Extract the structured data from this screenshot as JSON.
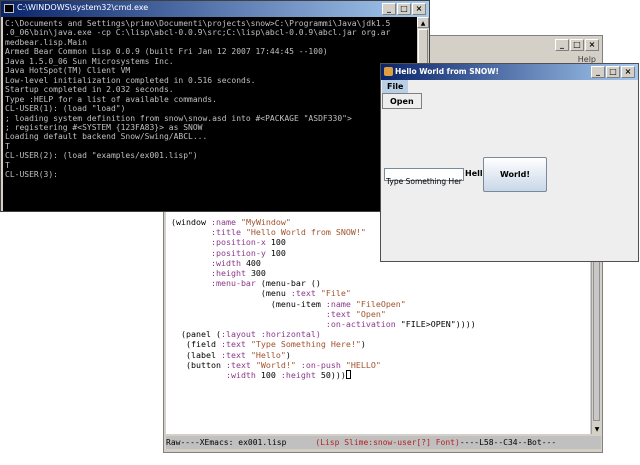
{
  "xemacs": {
    "help_label": "Help",
    "code_lines": [
      [
        {
          "t": "(window ",
          "c": ""
        },
        {
          "t": ":name ",
          "c": "kw"
        },
        {
          "t": "\"MyWindow\"",
          "c": "str"
        }
      ],
      [
        {
          "t": "        ",
          "c": ""
        },
        {
          "t": ":title ",
          "c": "kw"
        },
        {
          "t": "\"Hello World from SNOW!\"",
          "c": "str"
        }
      ],
      [
        {
          "t": "        ",
          "c": ""
        },
        {
          "t": ":position-x ",
          "c": "kw"
        },
        {
          "t": "100",
          "c": ""
        }
      ],
      [
        {
          "t": "        ",
          "c": ""
        },
        {
          "t": ":position-y ",
          "c": "kw"
        },
        {
          "t": "100",
          "c": ""
        }
      ],
      [
        {
          "t": "        ",
          "c": ""
        },
        {
          "t": ":width ",
          "c": "kw"
        },
        {
          "t": "400",
          "c": ""
        }
      ],
      [
        {
          "t": "        ",
          "c": ""
        },
        {
          "t": ":height ",
          "c": "kw"
        },
        {
          "t": "300",
          "c": ""
        }
      ],
      [
        {
          "t": "        ",
          "c": ""
        },
        {
          "t": ":menu-bar ",
          "c": "kw"
        },
        {
          "t": "(menu-bar ()",
          "c": ""
        }
      ],
      [
        {
          "t": "                  (menu ",
          "c": ""
        },
        {
          "t": ":text ",
          "c": "kw"
        },
        {
          "t": "\"File\"",
          "c": "str"
        }
      ],
      [
        {
          "t": "                    (menu-item ",
          "c": ""
        },
        {
          "t": ":name ",
          "c": "kw"
        },
        {
          "t": "\"FileOpen\"",
          "c": "str"
        }
      ],
      [
        {
          "t": "                               ",
          "c": ""
        },
        {
          "t": ":text ",
          "c": "kw"
        },
        {
          "t": "\"Open\"",
          "c": "str"
        }
      ],
      [
        {
          "t": "                               ",
          "c": ""
        },
        {
          "t": ":on-activation ",
          "c": "kw"
        },
        {
          "t": "\"FILE>OPEN\"))))",
          "c": ""
        }
      ],
      [
        {
          "t": "  (panel (",
          "c": ""
        },
        {
          "t": ":layout ",
          "c": "kw"
        },
        {
          "t": ":horizontal)",
          "c": "kw"
        }
      ],
      [
        {
          "t": "   (field ",
          "c": ""
        },
        {
          "t": ":text ",
          "c": "kw"
        },
        {
          "t": "\"Type Something Here!\"",
          "c": "str"
        },
        {
          "t": ")",
          "c": ""
        }
      ],
      [
        {
          "t": "   (label ",
          "c": ""
        },
        {
          "t": ":text ",
          "c": "kw"
        },
        {
          "t": "\"Hello\"",
          "c": "str"
        },
        {
          "t": ")",
          "c": ""
        }
      ],
      [
        {
          "t": "   (button ",
          "c": ""
        },
        {
          "t": ":text ",
          "c": "kw"
        },
        {
          "t": "\"World!\" ",
          "c": "str"
        },
        {
          "t": ":on-push ",
          "c": "kw"
        },
        {
          "t": "\"HELLO\"",
          "c": "str"
        }
      ],
      [
        {
          "t": "           ",
          "c": ""
        },
        {
          "t": ":width ",
          "c": "kw"
        },
        {
          "t": "100 ",
          "c": ""
        },
        {
          "t": ":height ",
          "c": "kw"
        },
        {
          "t": "50)))",
          "c": ""
        }
      ]
    ],
    "modeline": {
      "left": "Raw----XEmacs: ex001.lisp      ",
      "mode": "(Lisp Slime:snow-user[?] Font)",
      "right": "----L58--C34--Bot---"
    }
  },
  "cmd": {
    "title": "C:\\WINDOWS\\system32\\cmd.exe",
    "lines": [
      "C:\\Documents and Settings\\primo\\Documenti\\projects\\snow>C:\\Programmi\\Java\\jdk1.5",
      ".0_06\\bin\\java.exe -cp C:\\lisp\\abcl-0.0.9\\src;C:\\lisp\\abcl-0.0.9\\abcl.jar org.ar",
      "medbear.lisp.Main",
      "Armed Bear Common Lisp 0.0.9 (built Fri Jan 12 2007 17:44:45 --100)",
      "Java 1.5.0_06 Sun Microsystems Inc.",
      "Java HotSpot(TM) Client VM",
      "Low-level initialization completed in 0.516 seconds.",
      "Startup completed in 2.032 seconds.",
      "Type :HELP for a list of available commands.",
      "CL-USER(1): (load \"load\")",
      "; loading system definition from snow\\snow.asd into #<PACKAGE \"ASDF330\">",
      "; registering #<SYSTEM {123FA83}> as SNOW",
      "Loading default backend Snow/Swing/ABCL...",
      "T",
      "CL-USER(2): (load \"examples/ex001.lisp\")",
      "T",
      "CL-USER(3):"
    ]
  },
  "hello": {
    "title": "Hello World from SNOW!",
    "menu_file": "File",
    "menu_open": "Open",
    "field_value": "Type Something Here!",
    "label": "Hello",
    "button": "World!"
  },
  "window_buttons": {
    "minimize": "_",
    "maximize": "□",
    "close": "×"
  }
}
